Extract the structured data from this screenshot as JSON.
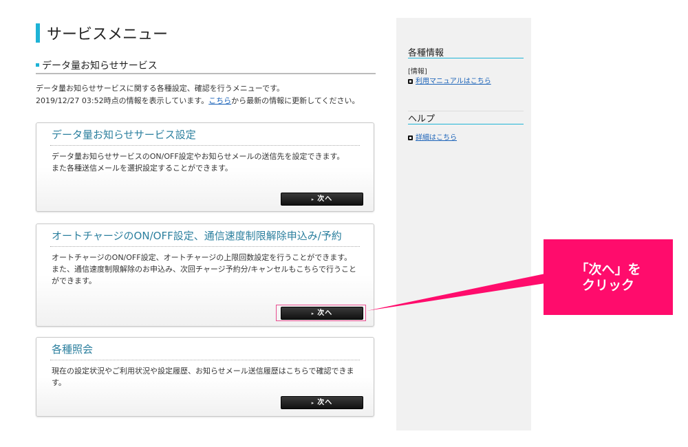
{
  "page_title": "サービスメニュー",
  "section_title": "データ量お知らせサービス",
  "intro": {
    "line1": "データ量お知らせサービスに関する各種設定、確認を行うメニューです。",
    "line2_prefix": "2019/12/27 03:52時点の情報を表示しています。",
    "line2_link": "こちら",
    "line2_suffix": "から最新の情報に更新してください。"
  },
  "cards": [
    {
      "title": "データ量お知らせサービス設定",
      "desc1": "データ量お知らせサービスのON/OFF設定やお知らせメールの送信先を設定できます。",
      "desc2": "また各種送信メールを選択設定することができます。",
      "button": "次へ"
    },
    {
      "title": "オートチャージのON/OFF設定、通信速度制限解除申込み/予約",
      "desc1": "オートチャージのON/OFF設定、オートチャージの上限回数設定を行うことができます。",
      "desc2": "また、通信速度制限解除のお申込み、次回チャージ予約分/キャンセルもこちらで行うことができます。",
      "button": "次へ"
    },
    {
      "title": "各種照会",
      "desc1": "現在の設定状況やご利用状況や設定履歴、お知らせメール送信履歴はこちらで確認できます。",
      "button": "次へ"
    }
  ],
  "sidebar": {
    "info_heading": "各種情報",
    "info_sub": "[情報]",
    "info_link": "利用マニュアルはこちら",
    "help_heading": "ヘルプ",
    "help_link": "詳細はこちら"
  },
  "callout": {
    "line1": "「次へ」を",
    "line2": "クリック"
  },
  "colors": {
    "accent": "#1eb3d6",
    "callout": "#ff0c6c",
    "card_title": "#2b7f9e",
    "link": "#1a62b8"
  }
}
